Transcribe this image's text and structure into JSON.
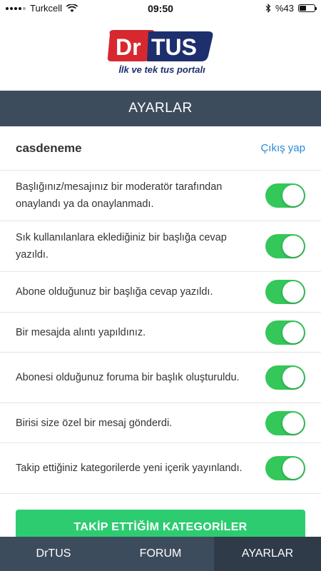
{
  "status_bar": {
    "carrier": "Turkcell",
    "time": "09:50",
    "battery_text": "%43",
    "battery_level": 0.43,
    "icons": [
      "signal-icon",
      "wifi-icon",
      "bluetooth-icon",
      "battery-icon"
    ]
  },
  "logo": {
    "brand_dr": "Dr",
    "brand_tus": "TUS",
    "slogan": "İlk ve tek tus portalı",
    "colors": {
      "red": "#d7282f",
      "navy": "#1e2f6e"
    }
  },
  "header": {
    "title": "AYARLAR"
  },
  "account": {
    "username": "casdeneme",
    "logout_label": "Çıkış yap"
  },
  "settings": [
    {
      "label": "Başlığınız/mesajınız bir moderatör tarafından onaylandı ya da onaylanmadı.",
      "enabled": true
    },
    {
      "label": "Sık kullanılanlara eklediğiniz bir başlığa cevap yazıldı.",
      "enabled": true
    },
    {
      "label": "Abone olduğunuz bir başlığa cevap yazıldı.",
      "enabled": true
    },
    {
      "label": "Bir mesajda alıntı yapıldınız.",
      "enabled": true
    },
    {
      "label": "Abonesi olduğunuz foruma bir başlık oluşturuldu.",
      "enabled": true
    },
    {
      "label": "Birisi size özel bir mesaj gönderdi.",
      "enabled": true
    },
    {
      "label": "Takip ettiğiniz kategorilerde yeni içerik yayınlandı.",
      "enabled": true
    }
  ],
  "follow_button_label": "TAKİP ETTİĞİM KATEGORİLER",
  "tabs": [
    {
      "label": "DrTUS",
      "active": false
    },
    {
      "label": "FORUM",
      "active": false
    },
    {
      "label": "AYARLAR",
      "active": true
    }
  ],
  "colors": {
    "header_bg": "#3d4c5d",
    "toggle_on": "#34c759",
    "button_green": "#2ecc71",
    "link_blue": "#2b8ad6"
  }
}
